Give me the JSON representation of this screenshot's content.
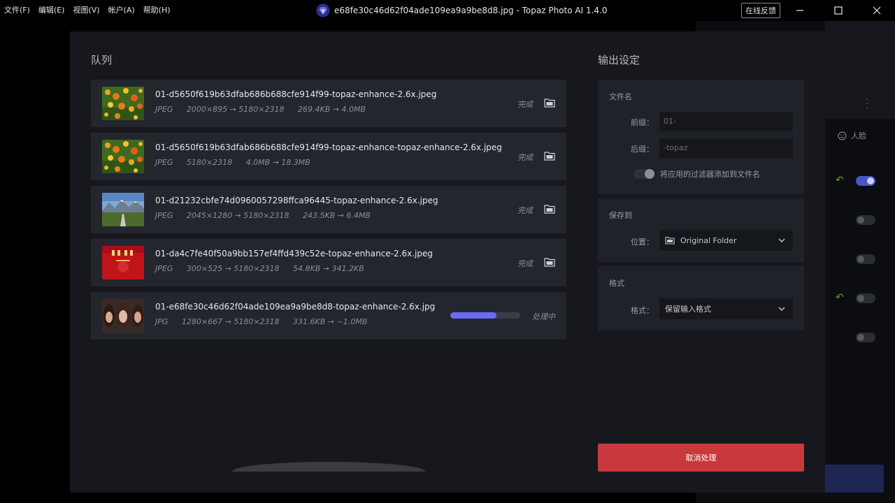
{
  "menu": [
    {
      "label": "文件(F)"
    },
    {
      "label": "编辑(E)"
    },
    {
      "label": "视图(V)"
    },
    {
      "label": "帐户(A)"
    },
    {
      "label": "帮助(H)"
    }
  ],
  "window_title": "e68fe30c46d62f04ade109ea9a9be8d8.jpg - Topaz Photo AI 1.4.0",
  "feedback_label": "在线反馈",
  "background": {
    "face_label": "人脸"
  },
  "queue": {
    "title": "队列",
    "items": [
      {
        "name": "01-d5650f619b63dfab686b688cfe914f99-topaz-enhance-2.6x.jpeg",
        "format": "JPEG",
        "dims": "2000×895 → 5180×2318",
        "size": "269.4KB → 4.0MB",
        "status": "完成",
        "thumb": "flowers"
      },
      {
        "name": "01-d5650f619b63dfab686b688cfe914f99-topaz-enhance-topaz-enhance-2.6x.jpeg",
        "format": "JPEG",
        "dims": "5180×2318",
        "size": "4.0MB → 18.3MB",
        "status": "完成",
        "thumb": "flowers"
      },
      {
        "name": "01-d21232cbfe74d0960057298ffca96445-topaz-enhance-2.6x.jpeg",
        "format": "JPEG",
        "dims": "2045×1280 → 5180×2318",
        "size": "243.5KB → 6.4MB",
        "status": "完成",
        "thumb": "mountain"
      },
      {
        "name": "01-da4c7fe40f50a9bb157ef4ffd439c52e-topaz-enhance-2.6x.jpeg",
        "format": "JPEG",
        "dims": "300×525 → 5180×2318",
        "size": "54.8KB → 341.2KB",
        "status": "完成",
        "thumb": "red"
      },
      {
        "name": "01-e68fe30c46d62f04ade109ea9a9be8d8-topaz-enhance-2.6x.jpg",
        "format": "JPG",
        "dims": "1280×667 → 5180×2318",
        "size": "331.6KB → ~1.0MB",
        "status": "处理中",
        "thumb": "faces",
        "progress": 0.66
      }
    ]
  },
  "settings": {
    "title": "输出设定",
    "filename": {
      "title": "文件名",
      "prefix_label": "前缀：",
      "prefix_value": "01-",
      "suffix_label": "后缀：",
      "suffix_value": "-topaz",
      "toggle_label": "将应用的过滤器添加到文件名"
    },
    "save": {
      "title": "保存到",
      "location_label": "位置：",
      "location_value": "Original Folder"
    },
    "format": {
      "title": "格式",
      "format_label": "格式：",
      "format_value": "保留输入格式"
    },
    "cancel_label": "取消处理"
  },
  "colors": {
    "accent": "#6b6cf2",
    "cancel": "#c9383a"
  }
}
